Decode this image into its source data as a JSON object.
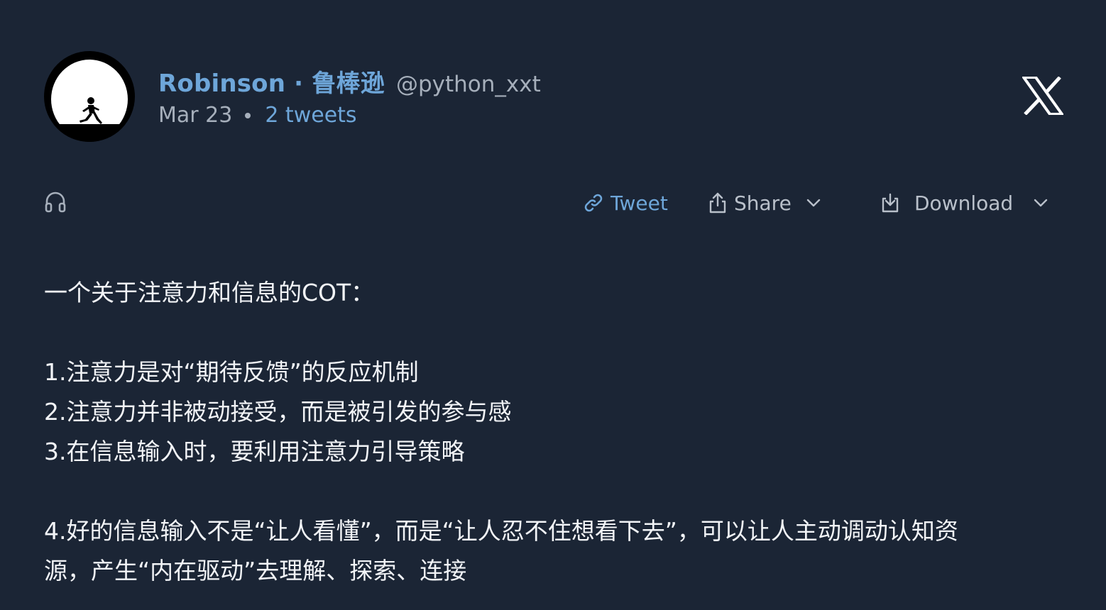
{
  "author": {
    "display_name": "Robinson · 鲁棒逊",
    "handle": "@python_xxt",
    "avatar_icon": "running-child-moon-avatar"
  },
  "meta": {
    "date": "Mar 23",
    "tweets_count": "2 tweets"
  },
  "brand": {
    "logo_icon": "x-logo-icon"
  },
  "actions": {
    "listen_icon": "headphones-icon",
    "tweet_label": "Tweet",
    "share_label": "Share",
    "download_label": "Download"
  },
  "content": {
    "lines": [
      "一个关于注意力和信息的COT：",
      "1.注意力是对“期待反馈”的反应机制",
      "2.注意力并非被动接受，而是被引发的参与感",
      "3.在信息输入时，要利用注意力引导策略",
      "4.好的信息输入不是“让人看懂”，而是“让人忍不住想看下去”，可以让人主动调动认知资",
      "源，产生“内在驱动”去理解、探索、连接"
    ]
  },
  "colors": {
    "background": "#1b2535",
    "accent_link": "#6ea6d9",
    "muted_text": "#a6afbb",
    "body_text": "#f2f4f7"
  }
}
